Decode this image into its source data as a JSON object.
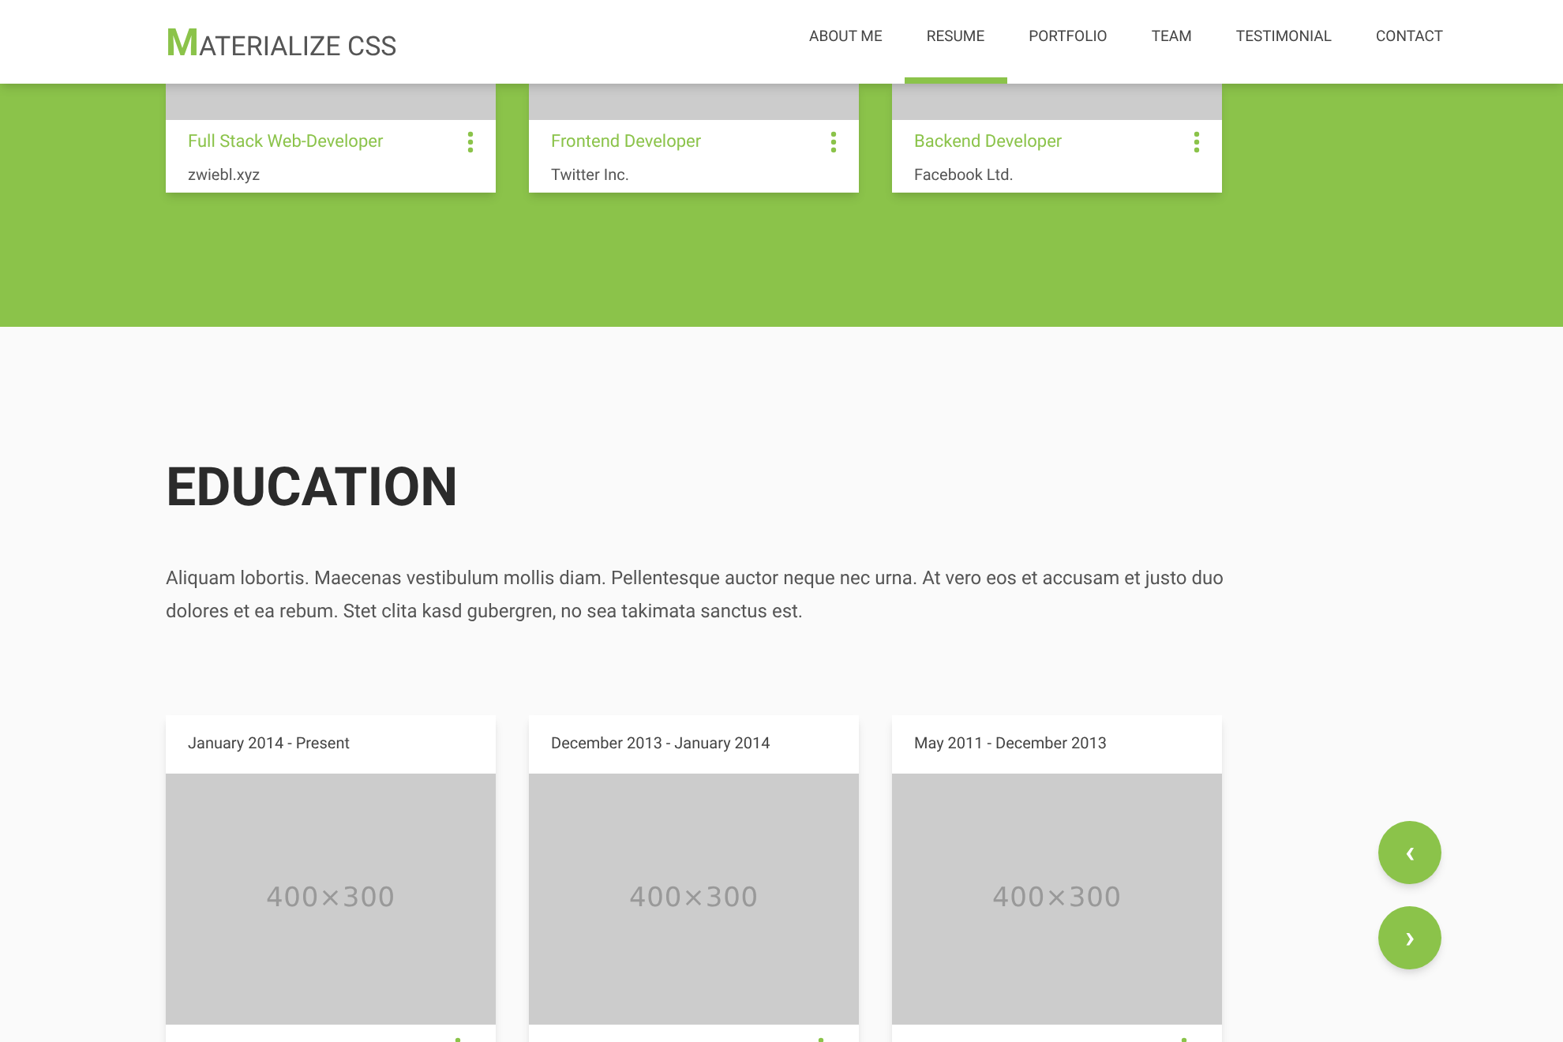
{
  "brand": {
    "initial": "M",
    "rest": "ATERIALIZE CSS"
  },
  "nav": [
    {
      "label": "ABOUT ME",
      "selected": false
    },
    {
      "label": "RESUME",
      "selected": true
    },
    {
      "label": "PORTFOLIO",
      "selected": false
    },
    {
      "label": "TEAM",
      "selected": false
    },
    {
      "label": "TESTIMONIAL",
      "selected": false
    },
    {
      "label": "CONTACT",
      "selected": false
    }
  ],
  "experience_cards": [
    {
      "title": "Full Stack Web-Developer",
      "subtitle": "zwiebl.xyz"
    },
    {
      "title": "Frontend Developer",
      "subtitle": "Twitter Inc."
    },
    {
      "title": "Backend Developer",
      "subtitle": "Facebook Ltd."
    }
  ],
  "education": {
    "heading": "EDUCATION",
    "text": "Aliquam lobortis. Maecenas vestibulum mollis diam. Pellentesque auctor neque nec urna. At vero eos et accusam et justo duo dolores et ea rebum. Stet clita kasd gubergren, no sea takimata sanctus est.",
    "cards": [
      {
        "date": "January 2014 - Present",
        "image_label": "400×300"
      },
      {
        "date": "December 2013 - January 2014",
        "image_label": "400×300"
      },
      {
        "date": "May 2011 - December 2013",
        "image_label": "400×300"
      }
    ]
  },
  "carousel": {
    "prev": "‹",
    "next": "›"
  }
}
